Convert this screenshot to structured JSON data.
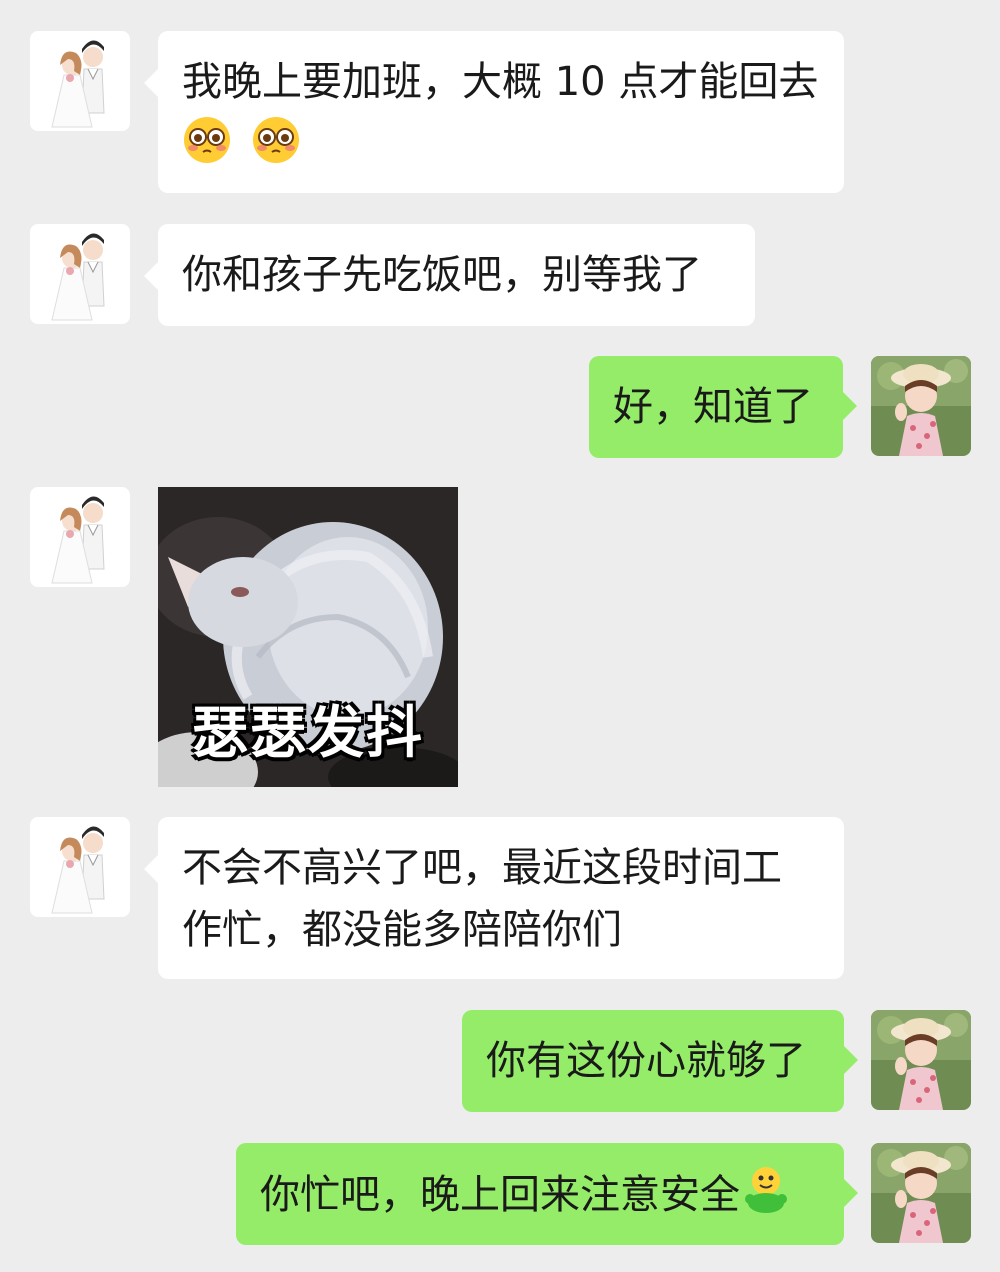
{
  "messages": [
    {
      "side": "left",
      "text": "我晚上要加班，大概 10 点才能回去",
      "emoji": [
        "flushed-face",
        "flushed-face"
      ]
    },
    {
      "side": "left",
      "text": "你和孩子先吃饭吧，别等我了"
    },
    {
      "side": "right",
      "text": "好，知道了"
    },
    {
      "side": "left",
      "sticker_caption": "瑟瑟发抖",
      "sticker": "curled-white-cat"
    },
    {
      "side": "left",
      "text_line1": "不会不高兴了吧，最近这段时间工",
      "text_line2": "作忙，都没能多陪陪你们"
    },
    {
      "side": "right",
      "text": "你有这份心就够了"
    },
    {
      "side": "right",
      "text": "你忙吧，晚上回来注意安全",
      "emoji": [
        "green-smiley"
      ]
    }
  ],
  "colors": {
    "background": "#ededed",
    "left_bubble": "#ffffff",
    "right_bubble": "#95ec69"
  }
}
